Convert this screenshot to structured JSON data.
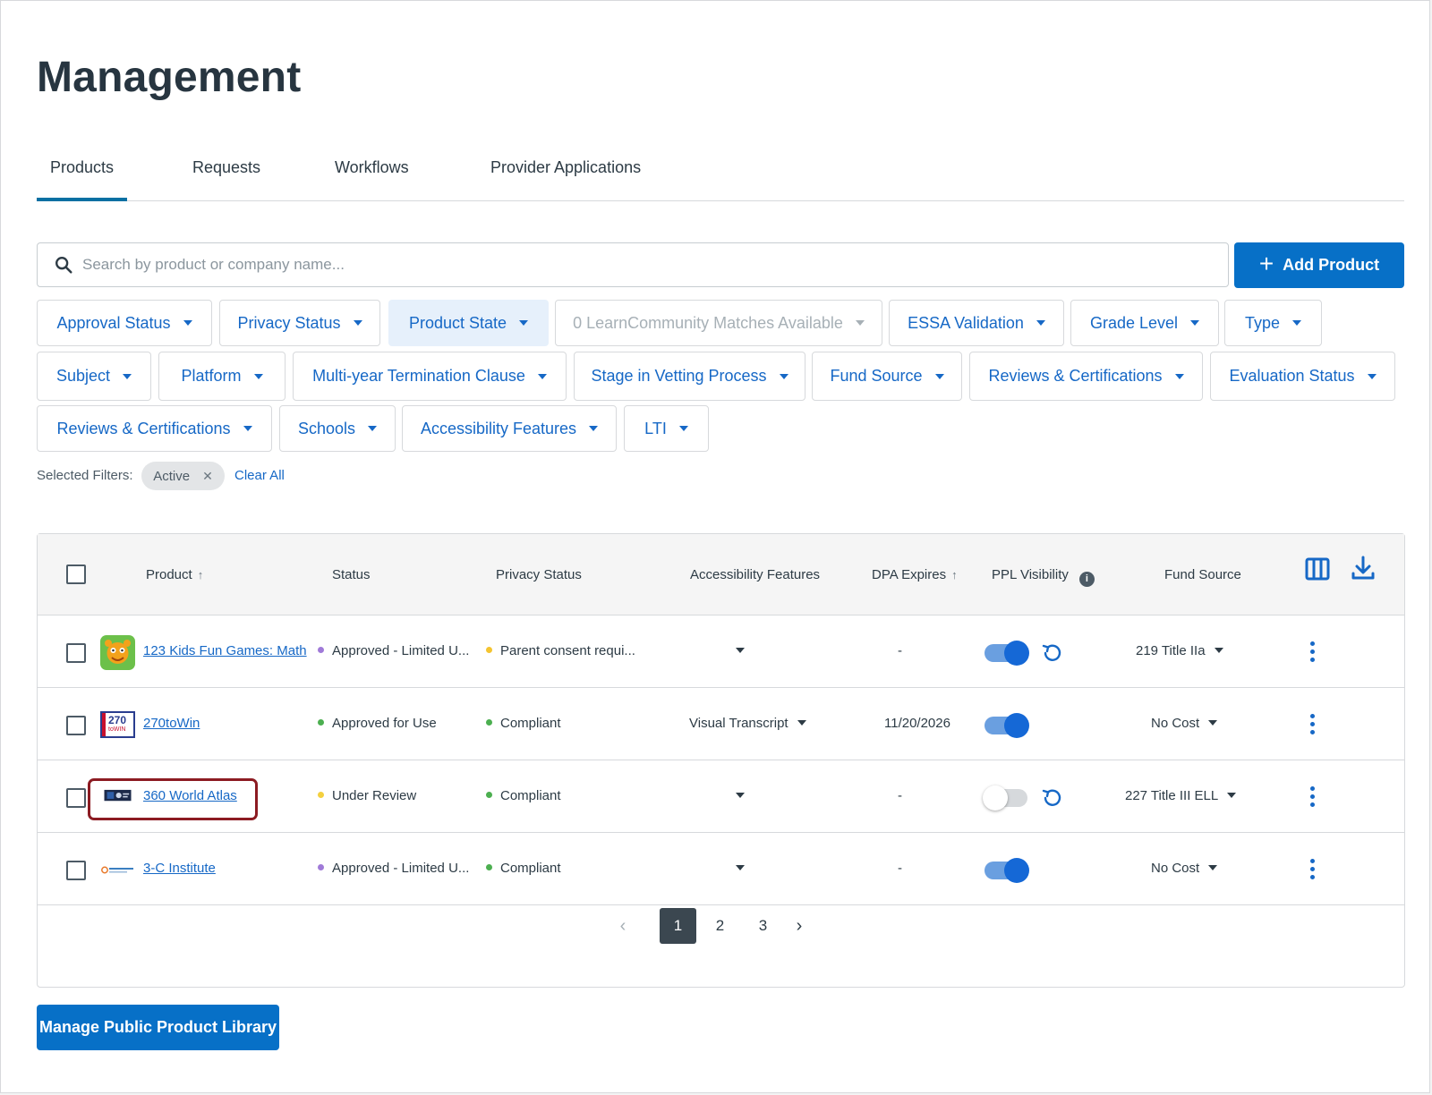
{
  "page": {
    "title": "Management"
  },
  "tabs": [
    {
      "label": "Products",
      "active": true
    },
    {
      "label": "Requests"
    },
    {
      "label": "Workflows"
    },
    {
      "label": "Provider Applications"
    }
  ],
  "search": {
    "placeholder": "Search by product or company name...",
    "value": ""
  },
  "add_product": {
    "label": "Add Product",
    "icon": "plus-icon"
  },
  "filters": [
    "Approval Status",
    "Privacy Status",
    "Product State",
    "0 LearnCommunity Matches Available",
    "ESSA Validation",
    "Grade Level",
    "Type",
    "Subject",
    "Platform",
    "Multi-year Termination Clause",
    "Stage in Vetting Process",
    "Fund Source",
    "Reviews & Certifications",
    "Evaluation Status",
    "Reviews & Certifications",
    "Schools",
    "Accessibility Features",
    "LTI"
  ],
  "selected_filters": {
    "label": "Selected Filters:",
    "items": [
      "Active"
    ],
    "clear_label": "Clear All"
  },
  "table": {
    "headers": {
      "product": "Product",
      "status": "Status",
      "privacy": "Privacy Status",
      "accessibility": "Accessibility Features",
      "dpa": "DPA Expires",
      "ppl": "PPL Visibility",
      "fund": "Fund Source"
    },
    "rows": [
      {
        "product": "123 Kids Fun Games: Math",
        "status": "Approved - Limited U...",
        "status_color": "#a07ad8",
        "privacy": "Parent consent requi...",
        "privacy_color": "#f4c430",
        "accessibility": "",
        "dpa": "-",
        "ppl_visible": true,
        "ppl_reset": true,
        "fund": "219 Title IIa"
      },
      {
        "product": "270toWin",
        "status": "Approved for Use",
        "status_color": "#4caf50",
        "privacy": "Compliant",
        "privacy_color": "#4caf50",
        "accessibility": "Visual Transcript",
        "dpa": "11/20/2026",
        "ppl_visible": true,
        "ppl_reset": false,
        "fund": "No Cost"
      },
      {
        "product": "360 World Atlas",
        "status": "Under Review",
        "status_color": "#f4d03f",
        "privacy": "Compliant",
        "privacy_color": "#4caf50",
        "accessibility": "",
        "dpa": "-",
        "ppl_visible": false,
        "ppl_reset": true,
        "fund": "227 Title III ELL"
      },
      {
        "product": "3-C Institute",
        "status": "Approved - Limited U...",
        "status_color": "#a07ad8",
        "privacy": "Compliant",
        "privacy_color": "#4caf50",
        "accessibility": "",
        "dpa": "-",
        "ppl_visible": true,
        "ppl_reset": false,
        "fund": "No Cost"
      }
    ]
  },
  "pagination": {
    "pages": [
      "1",
      "2",
      "3"
    ],
    "current": "1"
  },
  "logos": {
    "row2": {
      "top": "270",
      "bottom": "toWIN"
    }
  },
  "manage_library": {
    "label": "Manage Public Product Library"
  },
  "colors": {
    "primary": "#0770c7",
    "link": "#1668c6",
    "highlight": "#8c1b22"
  }
}
